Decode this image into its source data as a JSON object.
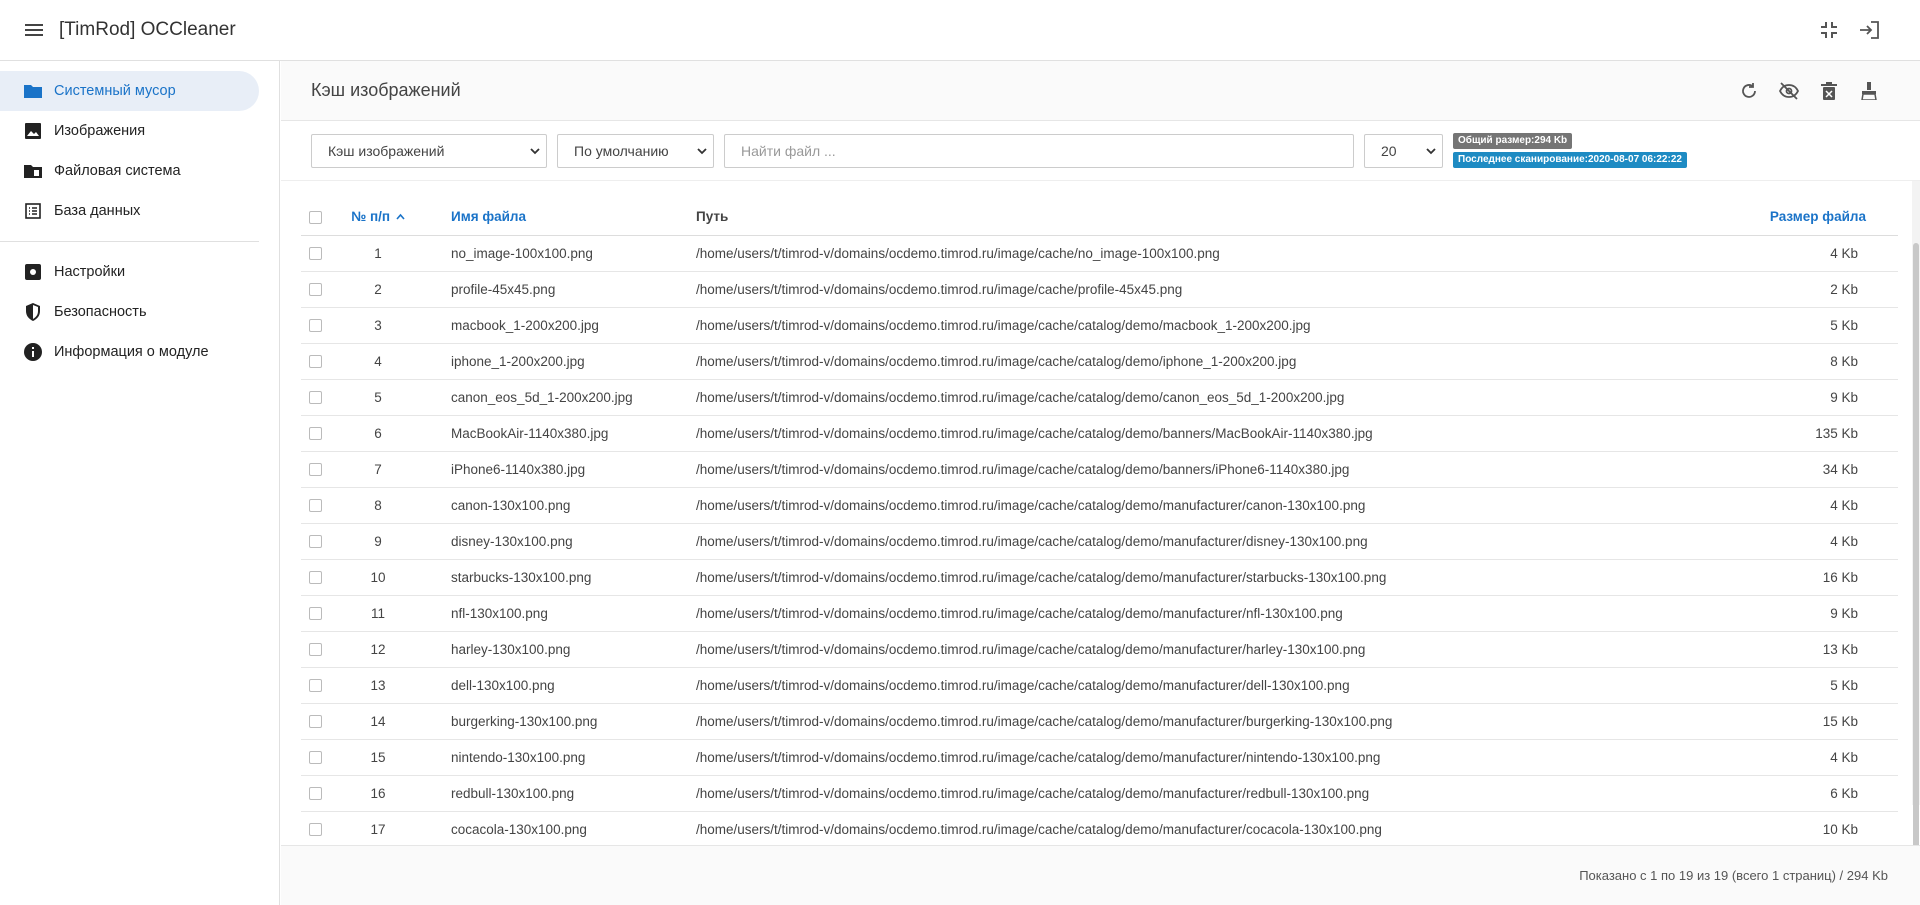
{
  "app": {
    "title": "[TimRod] OCCleaner"
  },
  "topbar": {
    "icons": [
      "menu-icon",
      "fullscreen-exit-icon",
      "logout-icon"
    ]
  },
  "sidebar": {
    "items": [
      {
        "label": "Системный мусор",
        "icon": "folder-icon",
        "active": true
      },
      {
        "label": "Изображения",
        "icon": "image-icon",
        "active": false
      },
      {
        "label": "Файловая система",
        "icon": "file-folder-icon",
        "active": false
      },
      {
        "label": "База данных",
        "icon": "list-icon",
        "active": false
      }
    ],
    "items2": [
      {
        "label": "Настройки",
        "icon": "settings-icon"
      },
      {
        "label": "Безопасность",
        "icon": "shield-icon"
      },
      {
        "label": "Информация о модуле",
        "icon": "info-icon"
      }
    ]
  },
  "main": {
    "title": "Кэш изображений",
    "header_icons": [
      "refresh-icon",
      "hide-icon",
      "delete-icon",
      "clean-icon"
    ]
  },
  "filters": {
    "type_select": "Кэш изображений",
    "sort_select": "По умолчанию",
    "search_placeholder": "Найти файл ...",
    "per_page": "20",
    "total_size": "Общий размер:294 Kb",
    "last_scan": "Последнее сканирование:2020-08-07 06:22:22"
  },
  "table": {
    "headers": {
      "num": "№ п/п",
      "name": "Имя файла",
      "path": "Путь",
      "size": "Размер файла"
    },
    "rows": [
      {
        "num": "1",
        "name": "no_image-100x100.png",
        "path": "/home/users/t/timrod-v/domains/ocdemo.timrod.ru/image/cache/no_image-100x100.png",
        "size": "4 Kb"
      },
      {
        "num": "2",
        "name": "profile-45x45.png",
        "path": "/home/users/t/timrod-v/domains/ocdemo.timrod.ru/image/cache/profile-45x45.png",
        "size": "2 Kb"
      },
      {
        "num": "3",
        "name": "macbook_1-200x200.jpg",
        "path": "/home/users/t/timrod-v/domains/ocdemo.timrod.ru/image/cache/catalog/demo/macbook_1-200x200.jpg",
        "size": "5 Kb"
      },
      {
        "num": "4",
        "name": "iphone_1-200x200.jpg",
        "path": "/home/users/t/timrod-v/domains/ocdemo.timrod.ru/image/cache/catalog/demo/iphone_1-200x200.jpg",
        "size": "8 Kb"
      },
      {
        "num": "5",
        "name": "canon_eos_5d_1-200x200.jpg",
        "path": "/home/users/t/timrod-v/domains/ocdemo.timrod.ru/image/cache/catalog/demo/canon_eos_5d_1-200x200.jpg",
        "size": "9 Kb"
      },
      {
        "num": "6",
        "name": "MacBookAir-1140x380.jpg",
        "path": "/home/users/t/timrod-v/domains/ocdemo.timrod.ru/image/cache/catalog/demo/banners/MacBookAir-1140x380.jpg",
        "size": "135 Kb"
      },
      {
        "num": "7",
        "name": "iPhone6-1140x380.jpg",
        "path": "/home/users/t/timrod-v/domains/ocdemo.timrod.ru/image/cache/catalog/demo/banners/iPhone6-1140x380.jpg",
        "size": "34 Kb"
      },
      {
        "num": "8",
        "name": "canon-130x100.png",
        "path": "/home/users/t/timrod-v/domains/ocdemo.timrod.ru/image/cache/catalog/demo/manufacturer/canon-130x100.png",
        "size": "4 Kb"
      },
      {
        "num": "9",
        "name": "disney-130x100.png",
        "path": "/home/users/t/timrod-v/domains/ocdemo.timrod.ru/image/cache/catalog/demo/manufacturer/disney-130x100.png",
        "size": "4 Kb"
      },
      {
        "num": "10",
        "name": "starbucks-130x100.png",
        "path": "/home/users/t/timrod-v/domains/ocdemo.timrod.ru/image/cache/catalog/demo/manufacturer/starbucks-130x100.png",
        "size": "16 Kb"
      },
      {
        "num": "11",
        "name": "nfl-130x100.png",
        "path": "/home/users/t/timrod-v/domains/ocdemo.timrod.ru/image/cache/catalog/demo/manufacturer/nfl-130x100.png",
        "size": "9 Kb"
      },
      {
        "num": "12",
        "name": "harley-130x100.png",
        "path": "/home/users/t/timrod-v/domains/ocdemo.timrod.ru/image/cache/catalog/demo/manufacturer/harley-130x100.png",
        "size": "13 Kb"
      },
      {
        "num": "13",
        "name": "dell-130x100.png",
        "path": "/home/users/t/timrod-v/domains/ocdemo.timrod.ru/image/cache/catalog/demo/manufacturer/dell-130x100.png",
        "size": "5 Kb"
      },
      {
        "num": "14",
        "name": "burgerking-130x100.png",
        "path": "/home/users/t/timrod-v/domains/ocdemo.timrod.ru/image/cache/catalog/demo/manufacturer/burgerking-130x100.png",
        "size": "15 Kb"
      },
      {
        "num": "15",
        "name": "nintendo-130x100.png",
        "path": "/home/users/t/timrod-v/domains/ocdemo.timrod.ru/image/cache/catalog/demo/manufacturer/nintendo-130x100.png",
        "size": "4 Kb"
      },
      {
        "num": "16",
        "name": "redbull-130x100.png",
        "path": "/home/users/t/timrod-v/domains/ocdemo.timrod.ru/image/cache/catalog/demo/manufacturer/redbull-130x100.png",
        "size": "6 Kb"
      },
      {
        "num": "17",
        "name": "cocacola-130x100.png",
        "path": "/home/users/t/timrod-v/domains/ocdemo.timrod.ru/image/cache/catalog/demo/manufacturer/cocacola-130x100.png",
        "size": "10 Kb"
      }
    ]
  },
  "footer": {
    "summary": "Показано с 1 по 19 из 19 (всего 1 страниц) / 294 Kb"
  }
}
